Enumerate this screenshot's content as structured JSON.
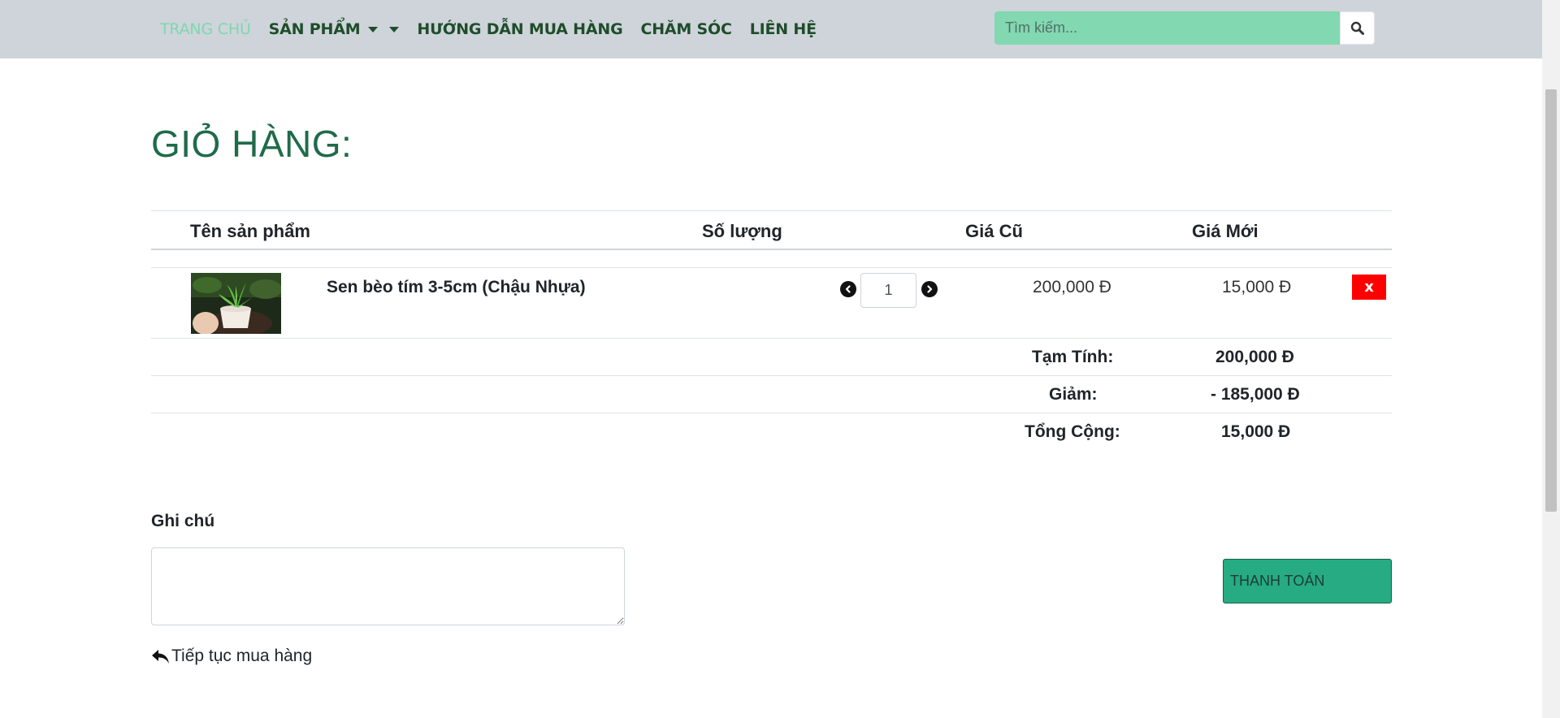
{
  "nav": {
    "items": [
      {
        "label": "TRANG CHỦ"
      },
      {
        "label": "SẢN PHẨM"
      },
      {
        "label": "HƯỚNG DẪN MUA HÀNG"
      },
      {
        "label": "CHĂM SÓC"
      },
      {
        "label": "LIÊN HỆ"
      }
    ],
    "search_placeholder": "Tìm kiếm...",
    "active_color": "#7fd7b0",
    "link_color": "#1f4d2b"
  },
  "cart": {
    "title": "GIỎ HÀNG:",
    "columns": [
      "Tên sản phẩm",
      "Số lượng",
      "Giá Cũ",
      "Giá Mới"
    ],
    "items": [
      {
        "name": "Sen bèo tím 3-5cm (Chậu Nhựa)",
        "quantity": "1",
        "old_price": "200,000 Đ",
        "new_price": "15,000 Đ",
        "remove_label": "x"
      }
    ],
    "summary": {
      "subtotal_label": "Tạm Tính:",
      "subtotal_value": "200,000 Đ",
      "discount_label": "Giảm:",
      "discount_value": "- 185,000 Đ",
      "total_label": "Tổng Cộng:",
      "total_value": "15,000 Đ"
    }
  },
  "note": {
    "label": "Ghi chú",
    "value": ""
  },
  "actions": {
    "continue_label": "Tiếp tục mua hàng",
    "checkout_label": "THANH TOÁN",
    "checkout_color": "#26ab83",
    "remove_color": "#ff0000"
  }
}
